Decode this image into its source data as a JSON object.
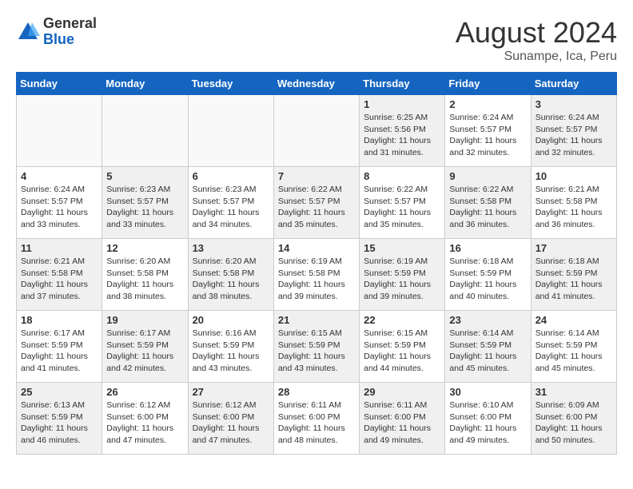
{
  "header": {
    "logo_general": "General",
    "logo_blue": "Blue",
    "month_year": "August 2024",
    "location": "Sunampe, Ica, Peru"
  },
  "days_of_week": [
    "Sunday",
    "Monday",
    "Tuesday",
    "Wednesday",
    "Thursday",
    "Friday",
    "Saturday"
  ],
  "weeks": [
    [
      {
        "day": "",
        "info": ""
      },
      {
        "day": "",
        "info": ""
      },
      {
        "day": "",
        "info": ""
      },
      {
        "day": "",
        "info": ""
      },
      {
        "day": "1",
        "info": "Sunrise: 6:25 AM\nSunset: 5:56 PM\nDaylight: 11 hours\nand 31 minutes."
      },
      {
        "day": "2",
        "info": "Sunrise: 6:24 AM\nSunset: 5:57 PM\nDaylight: 11 hours\nand 32 minutes."
      },
      {
        "day": "3",
        "info": "Sunrise: 6:24 AM\nSunset: 5:57 PM\nDaylight: 11 hours\nand 32 minutes."
      }
    ],
    [
      {
        "day": "4",
        "info": "Sunrise: 6:24 AM\nSunset: 5:57 PM\nDaylight: 11 hours\nand 33 minutes."
      },
      {
        "day": "5",
        "info": "Sunrise: 6:23 AM\nSunset: 5:57 PM\nDaylight: 11 hours\nand 33 minutes."
      },
      {
        "day": "6",
        "info": "Sunrise: 6:23 AM\nSunset: 5:57 PM\nDaylight: 11 hours\nand 34 minutes."
      },
      {
        "day": "7",
        "info": "Sunrise: 6:22 AM\nSunset: 5:57 PM\nDaylight: 11 hours\nand 35 minutes."
      },
      {
        "day": "8",
        "info": "Sunrise: 6:22 AM\nSunset: 5:57 PM\nDaylight: 11 hours\nand 35 minutes."
      },
      {
        "day": "9",
        "info": "Sunrise: 6:22 AM\nSunset: 5:58 PM\nDaylight: 11 hours\nand 36 minutes."
      },
      {
        "day": "10",
        "info": "Sunrise: 6:21 AM\nSunset: 5:58 PM\nDaylight: 11 hours\nand 36 minutes."
      }
    ],
    [
      {
        "day": "11",
        "info": "Sunrise: 6:21 AM\nSunset: 5:58 PM\nDaylight: 11 hours\nand 37 minutes."
      },
      {
        "day": "12",
        "info": "Sunrise: 6:20 AM\nSunset: 5:58 PM\nDaylight: 11 hours\nand 38 minutes."
      },
      {
        "day": "13",
        "info": "Sunrise: 6:20 AM\nSunset: 5:58 PM\nDaylight: 11 hours\nand 38 minutes."
      },
      {
        "day": "14",
        "info": "Sunrise: 6:19 AM\nSunset: 5:58 PM\nDaylight: 11 hours\nand 39 minutes."
      },
      {
        "day": "15",
        "info": "Sunrise: 6:19 AM\nSunset: 5:59 PM\nDaylight: 11 hours\nand 39 minutes."
      },
      {
        "day": "16",
        "info": "Sunrise: 6:18 AM\nSunset: 5:59 PM\nDaylight: 11 hours\nand 40 minutes."
      },
      {
        "day": "17",
        "info": "Sunrise: 6:18 AM\nSunset: 5:59 PM\nDaylight: 11 hours\nand 41 minutes."
      }
    ],
    [
      {
        "day": "18",
        "info": "Sunrise: 6:17 AM\nSunset: 5:59 PM\nDaylight: 11 hours\nand 41 minutes."
      },
      {
        "day": "19",
        "info": "Sunrise: 6:17 AM\nSunset: 5:59 PM\nDaylight: 11 hours\nand 42 minutes."
      },
      {
        "day": "20",
        "info": "Sunrise: 6:16 AM\nSunset: 5:59 PM\nDaylight: 11 hours\nand 43 minutes."
      },
      {
        "day": "21",
        "info": "Sunrise: 6:15 AM\nSunset: 5:59 PM\nDaylight: 11 hours\nand 43 minutes."
      },
      {
        "day": "22",
        "info": "Sunrise: 6:15 AM\nSunset: 5:59 PM\nDaylight: 11 hours\nand 44 minutes."
      },
      {
        "day": "23",
        "info": "Sunrise: 6:14 AM\nSunset: 5:59 PM\nDaylight: 11 hours\nand 45 minutes."
      },
      {
        "day": "24",
        "info": "Sunrise: 6:14 AM\nSunset: 5:59 PM\nDaylight: 11 hours\nand 45 minutes."
      }
    ],
    [
      {
        "day": "25",
        "info": "Sunrise: 6:13 AM\nSunset: 5:59 PM\nDaylight: 11 hours\nand 46 minutes."
      },
      {
        "day": "26",
        "info": "Sunrise: 6:12 AM\nSunset: 6:00 PM\nDaylight: 11 hours\nand 47 minutes."
      },
      {
        "day": "27",
        "info": "Sunrise: 6:12 AM\nSunset: 6:00 PM\nDaylight: 11 hours\nand 47 minutes."
      },
      {
        "day": "28",
        "info": "Sunrise: 6:11 AM\nSunset: 6:00 PM\nDaylight: 11 hours\nand 48 minutes."
      },
      {
        "day": "29",
        "info": "Sunrise: 6:11 AM\nSunset: 6:00 PM\nDaylight: 11 hours\nand 49 minutes."
      },
      {
        "day": "30",
        "info": "Sunrise: 6:10 AM\nSunset: 6:00 PM\nDaylight: 11 hours\nand 49 minutes."
      },
      {
        "day": "31",
        "info": "Sunrise: 6:09 AM\nSunset: 6:00 PM\nDaylight: 11 hours\nand 50 minutes."
      }
    ]
  ]
}
